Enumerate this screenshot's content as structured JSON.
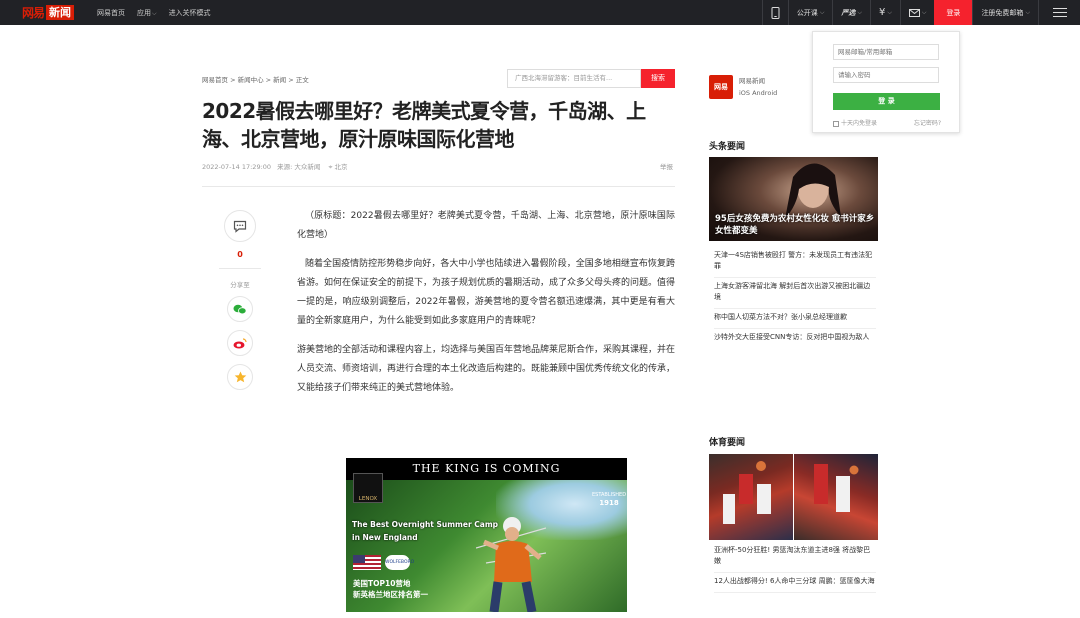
{
  "header": {
    "logo_brand": "网易",
    "logo_news": "新闻",
    "nav": [
      "网易首页",
      "应用",
      "进入关怀模式"
    ],
    "right": {
      "public_class": "公开课",
      "yanxuan": "严选",
      "pay_icon": "¥",
      "login": "登录",
      "register": "注册免费邮箱"
    }
  },
  "login_popup": {
    "email_placeholder": "网易邮箱/常用邮箱",
    "password_placeholder": "请输入密码",
    "submit": "登 录",
    "remember": "十天内免登录",
    "forgot": "忘记密码?"
  },
  "article": {
    "breadcrumb": "网易首页 > 新闻中心 > 新闻 > 正文",
    "search_placeholder": "广西北海滞留游客：目前生活有...",
    "search_button": "搜索",
    "title": "2022暑假去哪里好？老牌美式夏令营，千岛湖、上海、北京营地，原汁原味国际化营地",
    "datetime": "2022-07-14 17:29:00",
    "source": "来源: 大众新闻",
    "location": "北京",
    "report": "举报",
    "comment_count": "0",
    "share_label": "分享至",
    "paragraphs": [
      "（原标题：2022暑假去哪里好？老牌美式夏令营，千岛湖、上海、北京营地，原汁原味国际化营地）",
      "随着全国疫情防控形势稳步向好，各大中小学也陆续进入暑假阶段，全国多地相继宣布恢复跨省游。如何在保证安全的前提下，为孩子规划优质的暑期活动，成了众多父母头疼的问题。值得一提的是，响应级别调整后，2022年暑假，游美营地的夏令营名额迅速爆满，其中更是有看大量的全新家庭用户，为什么能受到如此多家庭用户的青睐呢？",
      "游美营地的全部活动和课程内容上，均选择与美国百年营地品牌莱尼斯合作，采购其课程，并在人员交流、师资培训，再进行合理的本土化改造后构建的。既能兼顾中国优秀传统文化的传承，又能给孩子们带来纯正的美式营地体验。"
    ],
    "ad": {
      "banner": "THE KING IS COMING",
      "brand": "LENOX",
      "established": "ESTABLISHED",
      "year": "1918",
      "tagline_1": "The Best Overnight Summer Camp",
      "tagline_2": "in New England",
      "partner": "WOLFEBORO",
      "rank_1": "美国TOP10营地",
      "rank_2": "新英格兰地区排名第一"
    }
  },
  "sidebar": {
    "app_logo": "网易",
    "app_name": "网易新闻",
    "app_os": "iOS    Android",
    "headlines_title": "头条要闻",
    "headline_image_caption": "95后女孩免费为农村女性化妆 愈书计家乡女性都变美",
    "headlines": [
      "天津一4S店销售被殴打 警方：未发现员工有违法犯罪",
      "上海女游客滞留北海 解封后首次出游又被困北疆边境",
      "称中国人切菜方法不对？张小泉总经理道歉",
      "沙特外交大臣接受CNN专访：反对把中国视为敌人"
    ],
    "sports_title": "体育要闻",
    "sports": [
      "亚洲杯-50分狂胜! 男篮淘汰东道主进8强 将战黎巴嫩",
      "12人出战都得分! 6人命中三分球 周鹏：篮筐像大海"
    ]
  }
}
